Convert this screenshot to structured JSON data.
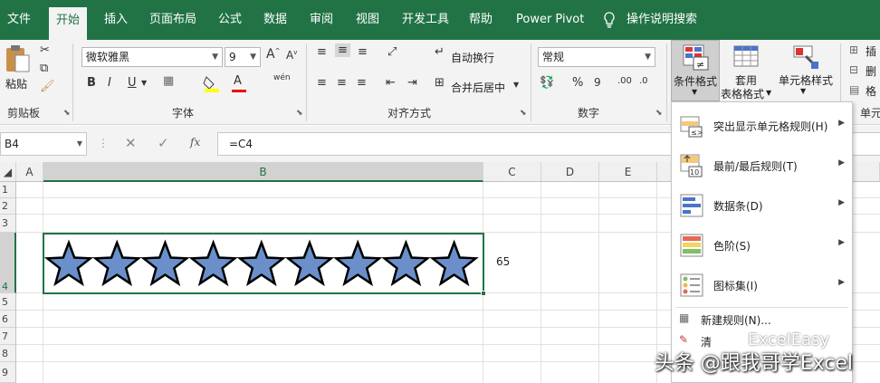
{
  "tabs": [
    "文件",
    "开始",
    "插入",
    "页面布局",
    "公式",
    "数据",
    "审阅",
    "视图",
    "开发工具",
    "帮助",
    "Power Pivot"
  ],
  "tell_me": "操作说明搜索",
  "clipboard": {
    "paste": "粘贴",
    "group": "剪贴板"
  },
  "font": {
    "name": "微软雅黑",
    "size": "9",
    "group": "字体",
    "bold": "B",
    "italic": "I",
    "underline": "U",
    "color_a": "A",
    "wen": "wén"
  },
  "alignment": {
    "wrap": "自动换行",
    "merge": "合并后居中",
    "group": "对齐方式"
  },
  "number": {
    "format": "常规",
    "percent": "%",
    "comma": "9",
    "group": "数字"
  },
  "styles": {
    "conditional": "条件格式",
    "table_format_l1": "套用",
    "table_format_l2": "表格格式",
    "cell_styles": "单元格样式"
  },
  "cells": {
    "insert": "插",
    "delete": "删",
    "format": "格",
    "group": "单元"
  },
  "formula_bar": {
    "name_box": "B4",
    "fx": "fx",
    "formula": "=C4"
  },
  "columns": [
    "A",
    "B",
    "C",
    "D",
    "E"
  ],
  "rows": [
    "1",
    "2",
    "3",
    "4",
    "5",
    "6",
    "7",
    "8",
    "9"
  ],
  "cell_c4": "65",
  "rating": {
    "stars": 9,
    "shown": 9,
    "color": "#6a8fcb"
  },
  "menu": {
    "items": [
      {
        "label": "突出显示单元格规则(H)"
      },
      {
        "label": "最前/最后规则(T)"
      },
      {
        "label": "数据条(D)"
      },
      {
        "label": "色阶(S)"
      },
      {
        "label": "图标集(I)"
      }
    ],
    "new_rule": "新建规则(N)...",
    "clear": "清"
  },
  "watermark": "头条 @跟我哥学Excel",
  "watermark2": "ExcelEasy",
  "colors": {
    "accent": "#217346",
    "ribbon": "#f3f3f3",
    "star": "#6a8fcb"
  }
}
